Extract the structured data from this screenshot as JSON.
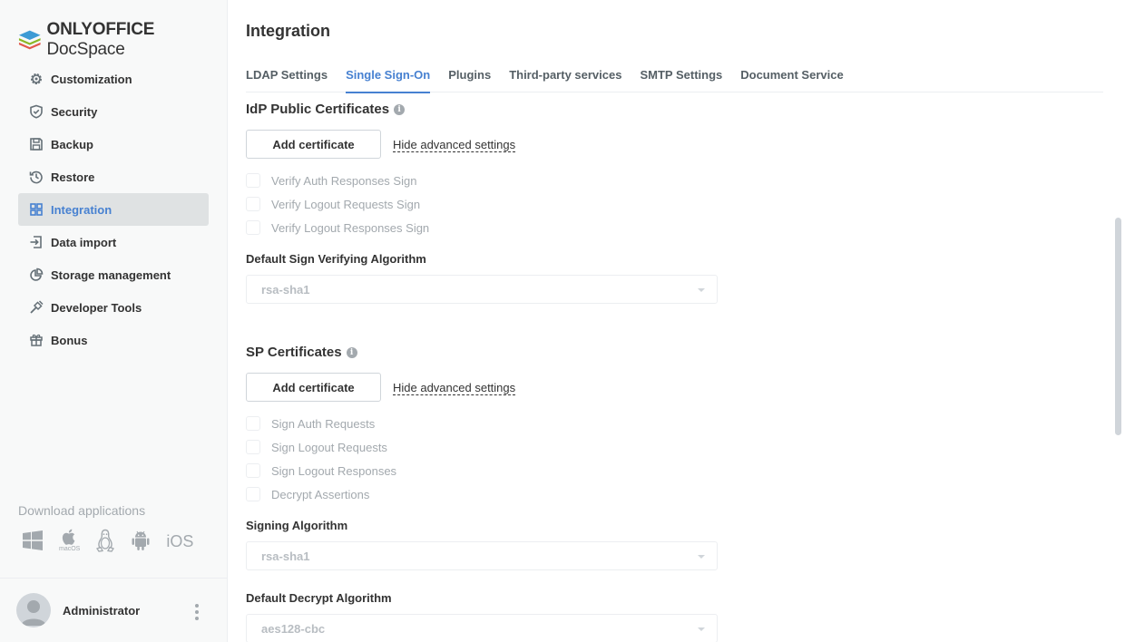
{
  "app": {
    "logo_bold": "ONLYOFFICE",
    "logo_rest": " DocSpace"
  },
  "sidebar": {
    "items": [
      {
        "label": "Customization",
        "icon": "gear-icon"
      },
      {
        "label": "Security",
        "icon": "shield-icon"
      },
      {
        "label": "Backup",
        "icon": "save-icon"
      },
      {
        "label": "Restore",
        "icon": "history-icon"
      },
      {
        "label": "Integration",
        "icon": "grid-icon",
        "active": true
      },
      {
        "label": "Data import",
        "icon": "import-icon"
      },
      {
        "label": "Storage management",
        "icon": "pie-chart-icon"
      },
      {
        "label": "Developer Tools",
        "icon": "wrench-icon"
      },
      {
        "label": "Bonus",
        "icon": "gift-icon"
      }
    ],
    "download_title": "Download applications",
    "apps": {
      "macos_label": "macOS",
      "ios_label": "iOS"
    },
    "profile_name": "Administrator"
  },
  "main": {
    "title": "Integration",
    "tabs": [
      {
        "label": "LDAP Settings"
      },
      {
        "label": "Single Sign-On",
        "active": true
      },
      {
        "label": "Plugins"
      },
      {
        "label": "Third-party services"
      },
      {
        "label": "SMTP Settings"
      },
      {
        "label": "Document Service"
      }
    ],
    "idp": {
      "title": "IdP Public Certificates",
      "add_button": "Add certificate",
      "hide_link": "Hide advanced settings",
      "checks": [
        "Verify Auth Responses Sign",
        "Verify Logout Requests Sign",
        "Verify Logout Responses Sign"
      ],
      "algo_label": "Default Sign Verifying Algorithm",
      "algo_value": "rsa-sha1"
    },
    "sp": {
      "title": "SP Certificates",
      "add_button": "Add certificate",
      "hide_link": "Hide advanced settings",
      "checks": [
        "Sign Auth Requests",
        "Sign Logout Requests",
        "Sign Logout Responses",
        "Decrypt Assertions"
      ],
      "sign_label": "Signing Algorithm",
      "sign_value": "rsa-sha1",
      "decrypt_label": "Default Decrypt Algorithm",
      "decrypt_value": "aes128-cbc"
    }
  },
  "colors": {
    "accent": "#4781d1",
    "disabled_text": "#a3a9ae",
    "border": "#d0d5da"
  }
}
